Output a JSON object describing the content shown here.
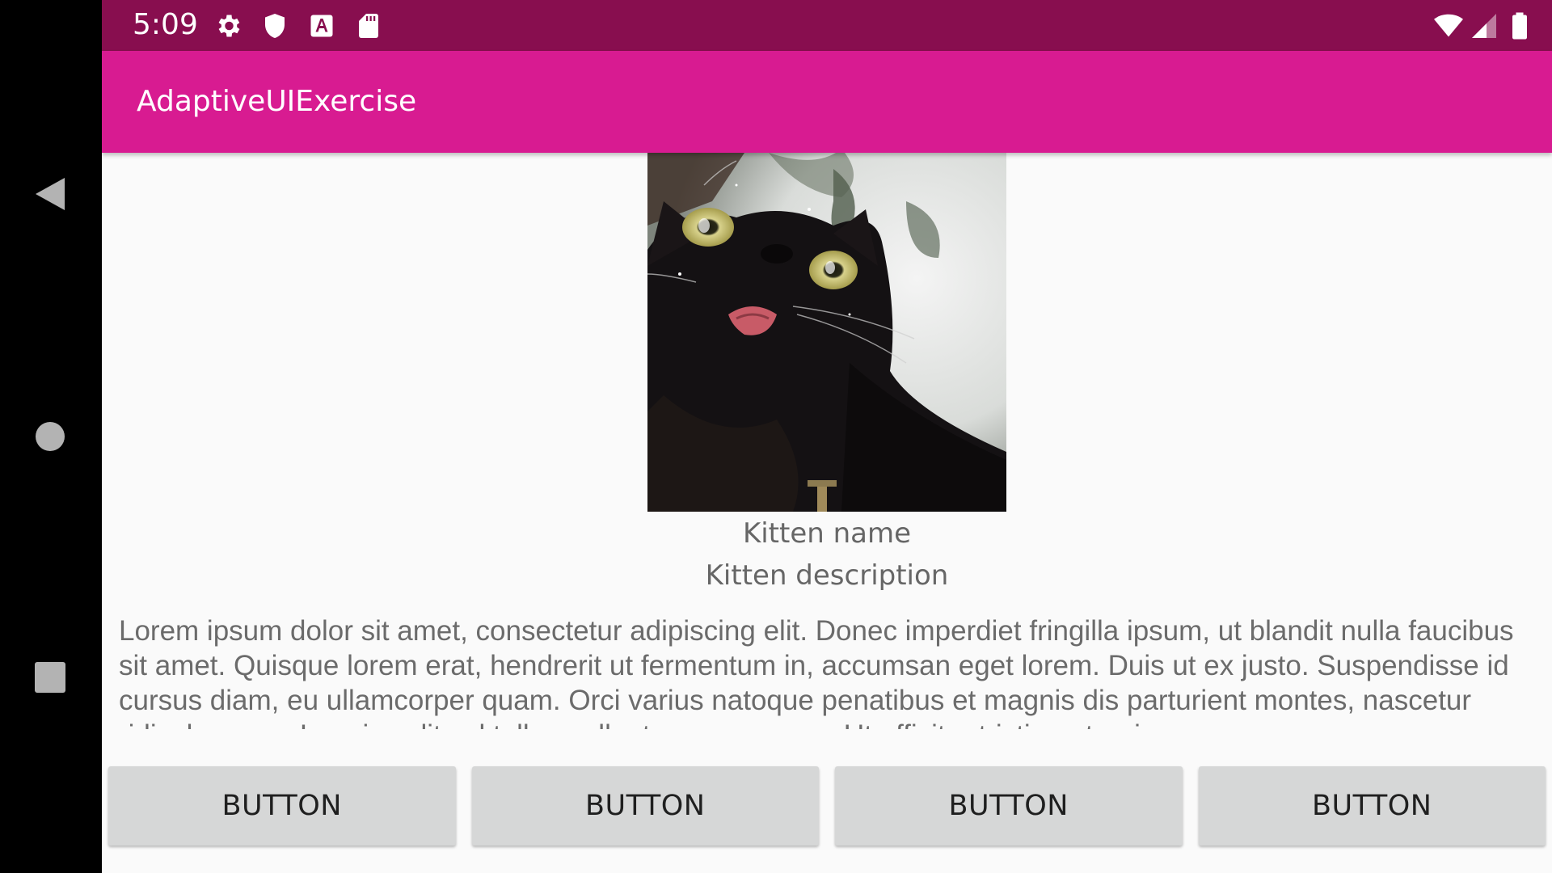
{
  "status_bar": {
    "time": "5:09",
    "left_icons": [
      "gear-icon",
      "shield-icon",
      "text-a-icon",
      "sd-card-icon"
    ],
    "right_icons": [
      "wifi-icon",
      "cellular-signal-icon",
      "battery-icon"
    ],
    "background_color": "#880e4f"
  },
  "app_bar": {
    "title": "AdaptiveUIExercise",
    "background_color": "#d81b91"
  },
  "kitten": {
    "name": "Kitten name",
    "description": "Kitten description"
  },
  "body_text": "Lorem ipsum dolor sit amet, consectetur adipiscing elit. Donec imperdiet fringilla ipsum, ut blandit nulla faucibus sit amet. Quisque lorem erat, hendrerit ut fermentum in, accumsan eget lorem. Duis ut ex justo. Suspendisse id cursus diam, eu ullamcorper quam. Orci varius natoque penatibus et magnis dis parturient montes, nascetur ridiculus mus. In quis velit vel tellus pellentesque congue. Ut efficitur tristique turpis",
  "buttons": [
    {
      "label": "BUTTON"
    },
    {
      "label": "BUTTON"
    },
    {
      "label": "BUTTON"
    },
    {
      "label": "BUTTON"
    }
  ],
  "navigation": {
    "icons": [
      "back-triangle-icon",
      "home-circle-icon",
      "recents-square-icon"
    ]
  }
}
